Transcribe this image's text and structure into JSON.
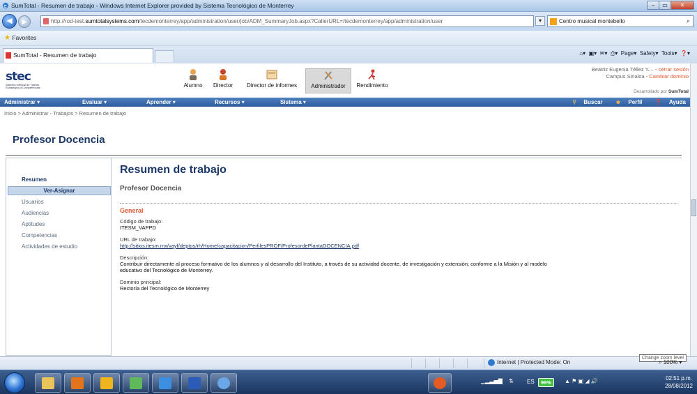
{
  "window": {
    "title": "SumTotal - Resumen de trabajo - Windows Internet Explorer provided by Sistema Tecnológico de Monterrey"
  },
  "addressbar": {
    "url_prefix": "http://rod-test.",
    "url_domain": "sumtotalsystems.com",
    "url_rest": "/tecdemonterrey/app/administration/user/job/ADM_SummaryJob.aspx?CallerURL=/tecdemonterrey/app/administration/user",
    "search_text": "Centro musical montebello"
  },
  "favorites": {
    "label": "Favorites"
  },
  "tabs": {
    "active_label": "SumTotal - Resumen de trabajo"
  },
  "commandbar": {
    "page": "Page",
    "safety": "Safety",
    "tools": "Tools"
  },
  "app": {
    "logo_text": "stec",
    "logo_sub": "Sistema Integral de Talento Estratégico y Competencias",
    "roles": [
      "Alumno",
      "Director",
      "Director de informes",
      "Administrador",
      "Rendimiento"
    ],
    "user_name": "Beatriz Eugenia Téllez Y....",
    "logout": "cerrar sesión",
    "campus": "Campus Sinaloa",
    "change_domain": "Cambiar dominio",
    "dev_prefix": "Desarrollado por",
    "dev_brand": "SumTotal"
  },
  "menu": {
    "items": [
      "Administrar",
      "Evaluar",
      "Aprender",
      "Recursos",
      "Sistema"
    ],
    "buscar": "Buscar",
    "perfil": "Perfil",
    "ayuda": "Ayuda"
  },
  "breadcrumb": "Inicio > Administrar - Trabajos > Resumen de trabajo",
  "page_title": "Profesor Docencia",
  "leftpanel": {
    "heading": "Resumen",
    "selected": "Ver-Asignar",
    "items": [
      "Usuarios",
      "Audiencias",
      "Aptitudes",
      "Competencias",
      "Actividades de estudio"
    ]
  },
  "content": {
    "title": "Resumen de trabajo",
    "subtitle": "Profesor Docencia",
    "section": "General",
    "code_label": "Código de trabajo:",
    "code_value": "ITESM_VAPPD",
    "url_label": "URL de trabajo:",
    "url_value": "http://sitios.itesm.mx/vayf/deptos/rh/Home/capacitacion/PerfilesPROF/ProfesordePlantaDOCENCIA.pdf",
    "desc_label": "Descripción:",
    "desc_line1": "Contribuir directamente al proceso formativo de los alumnos y al desarrollo del Instituto, a través de su actividad docente, de investigación y extensión; conforme a la Misión y al modelo",
    "desc_line2": "educativo del Tecnológico de Monterrey.",
    "domain_label": "Dominio principal:",
    "domain_value": "Rectoría del Tecnológico de Monterrey"
  },
  "statusbar": {
    "zone": "Internet | Protected Mode: On",
    "zoom_tip": "Change zoom level",
    "zoom": "100%"
  },
  "taskbar": {
    "lang": "ES",
    "battery": "99%",
    "time": "02:51 p.m.",
    "date": "28/08/2012"
  }
}
